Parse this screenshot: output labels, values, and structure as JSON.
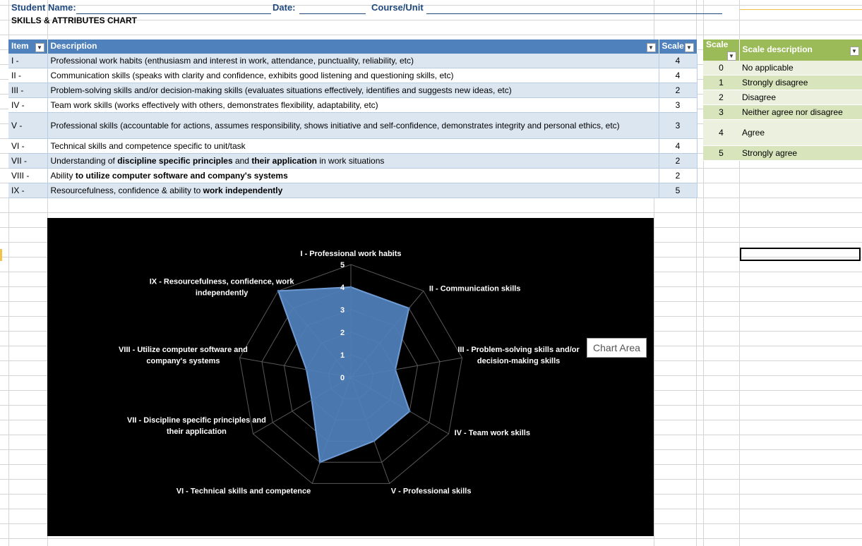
{
  "header": {
    "student_name_label": "Student Name:",
    "date_label": "Date:",
    "course_label": "Course/Unit"
  },
  "section_title": "SKILLS & ATTRIBUTES CHART",
  "skills_table": {
    "columns": [
      "Item",
      "Description",
      "Scale"
    ],
    "rows": [
      {
        "item": "I -",
        "desc_parts": [
          {
            "t": "Professional work habits (enthusiasm and interest in work, attendance, punctuality, reliability, etc)",
            "b": false
          }
        ],
        "scale": "4"
      },
      {
        "item": "II -",
        "desc_parts": [
          {
            "t": "Communication skills (speaks with clarity and confidence, exhibits good listening and questioning skills, etc)",
            "b": false
          }
        ],
        "scale": "4"
      },
      {
        "item": "III -",
        "desc_parts": [
          {
            "t": "Problem-solving skills and/or decision-making skills (evaluates situations effectively, identifies and suggests new ideas, etc)",
            "b": false
          }
        ],
        "scale": "2"
      },
      {
        "item": "IV -",
        "desc_parts": [
          {
            "t": "Team work skills (works effectively with others, demonstrates flexibility, adaptability, etc)",
            "b": false
          }
        ],
        "scale": "3"
      },
      {
        "item": "V -",
        "desc_parts": [
          {
            "t": "Professional skills (accountable for actions, assumes responsibility, shows initiative and  self-confidence, demonstrates integrity and personal ethics, etc)",
            "b": false
          }
        ],
        "scale": "3"
      },
      {
        "item": "VI -",
        "desc_parts": [
          {
            "t": "Technical skills and competence specific to unit/task",
            "b": false
          }
        ],
        "scale": "4"
      },
      {
        "item": "VII -",
        "desc_parts": [
          {
            "t": "Understanding of ",
            "b": false
          },
          {
            "t": "discipline specific principles",
            "b": true
          },
          {
            "t": " and ",
            "b": false
          },
          {
            "t": "their application",
            "b": true
          },
          {
            "t": " in work situations",
            "b": false
          }
        ],
        "scale": "2"
      },
      {
        "item": "VIII -",
        "desc_parts": [
          {
            "t": "Ability ",
            "b": false
          },
          {
            "t": "to utilize computer software and company's systems",
            "b": true
          }
        ],
        "scale": "2"
      },
      {
        "item": "IX -",
        "desc_parts": [
          {
            "t": "Resourcefulness, confidence & ability to ",
            "b": false
          },
          {
            "t": "work independently",
            "b": true
          }
        ],
        "scale": "5"
      }
    ]
  },
  "scale_table": {
    "columns": [
      "Scale",
      "Scale description"
    ],
    "rows": [
      {
        "scale": "0",
        "desc": "No applicable"
      },
      {
        "scale": "1",
        "desc": "Strongly disagree"
      },
      {
        "scale": "2",
        "desc": "Disagree"
      },
      {
        "scale": "3",
        "desc": "Neither agree nor disagree"
      },
      {
        "scale": "4",
        "desc": "Agree"
      },
      {
        "scale": "5",
        "desc": "Strongly agree"
      }
    ]
  },
  "tooltip": "Chart Area",
  "colors": {
    "chart_bg": "#000000",
    "fill": "#4f81bd",
    "grid": "#595959",
    "header_blue": "#4f81bd",
    "header_green": "#9bbb59"
  },
  "chart_data": {
    "type": "radar",
    "categories": [
      [
        "I - Professional work habits"
      ],
      [
        "II - Communication skills"
      ],
      [
        "III - Problem-solving skills and/or",
        "decision-making skills"
      ],
      [
        "IV - Team work skills"
      ],
      [
        "V - Professional skills"
      ],
      [
        "VI - Technical skills and competence"
      ],
      [
        "VII - Discipline specific principles and",
        "their application"
      ],
      [
        "VIII - Utilize computer software and",
        "company's systems"
      ],
      [
        "IX - Resourcefulness, confidence, work",
        "independently"
      ]
    ],
    "values": [
      4,
      4,
      2,
      3,
      3,
      4,
      2,
      2,
      5
    ],
    "range": [
      0,
      5
    ],
    "ticks": [
      "0",
      "1",
      "2",
      "3",
      "4",
      "5"
    ],
    "grid": true,
    "legend": "none"
  }
}
